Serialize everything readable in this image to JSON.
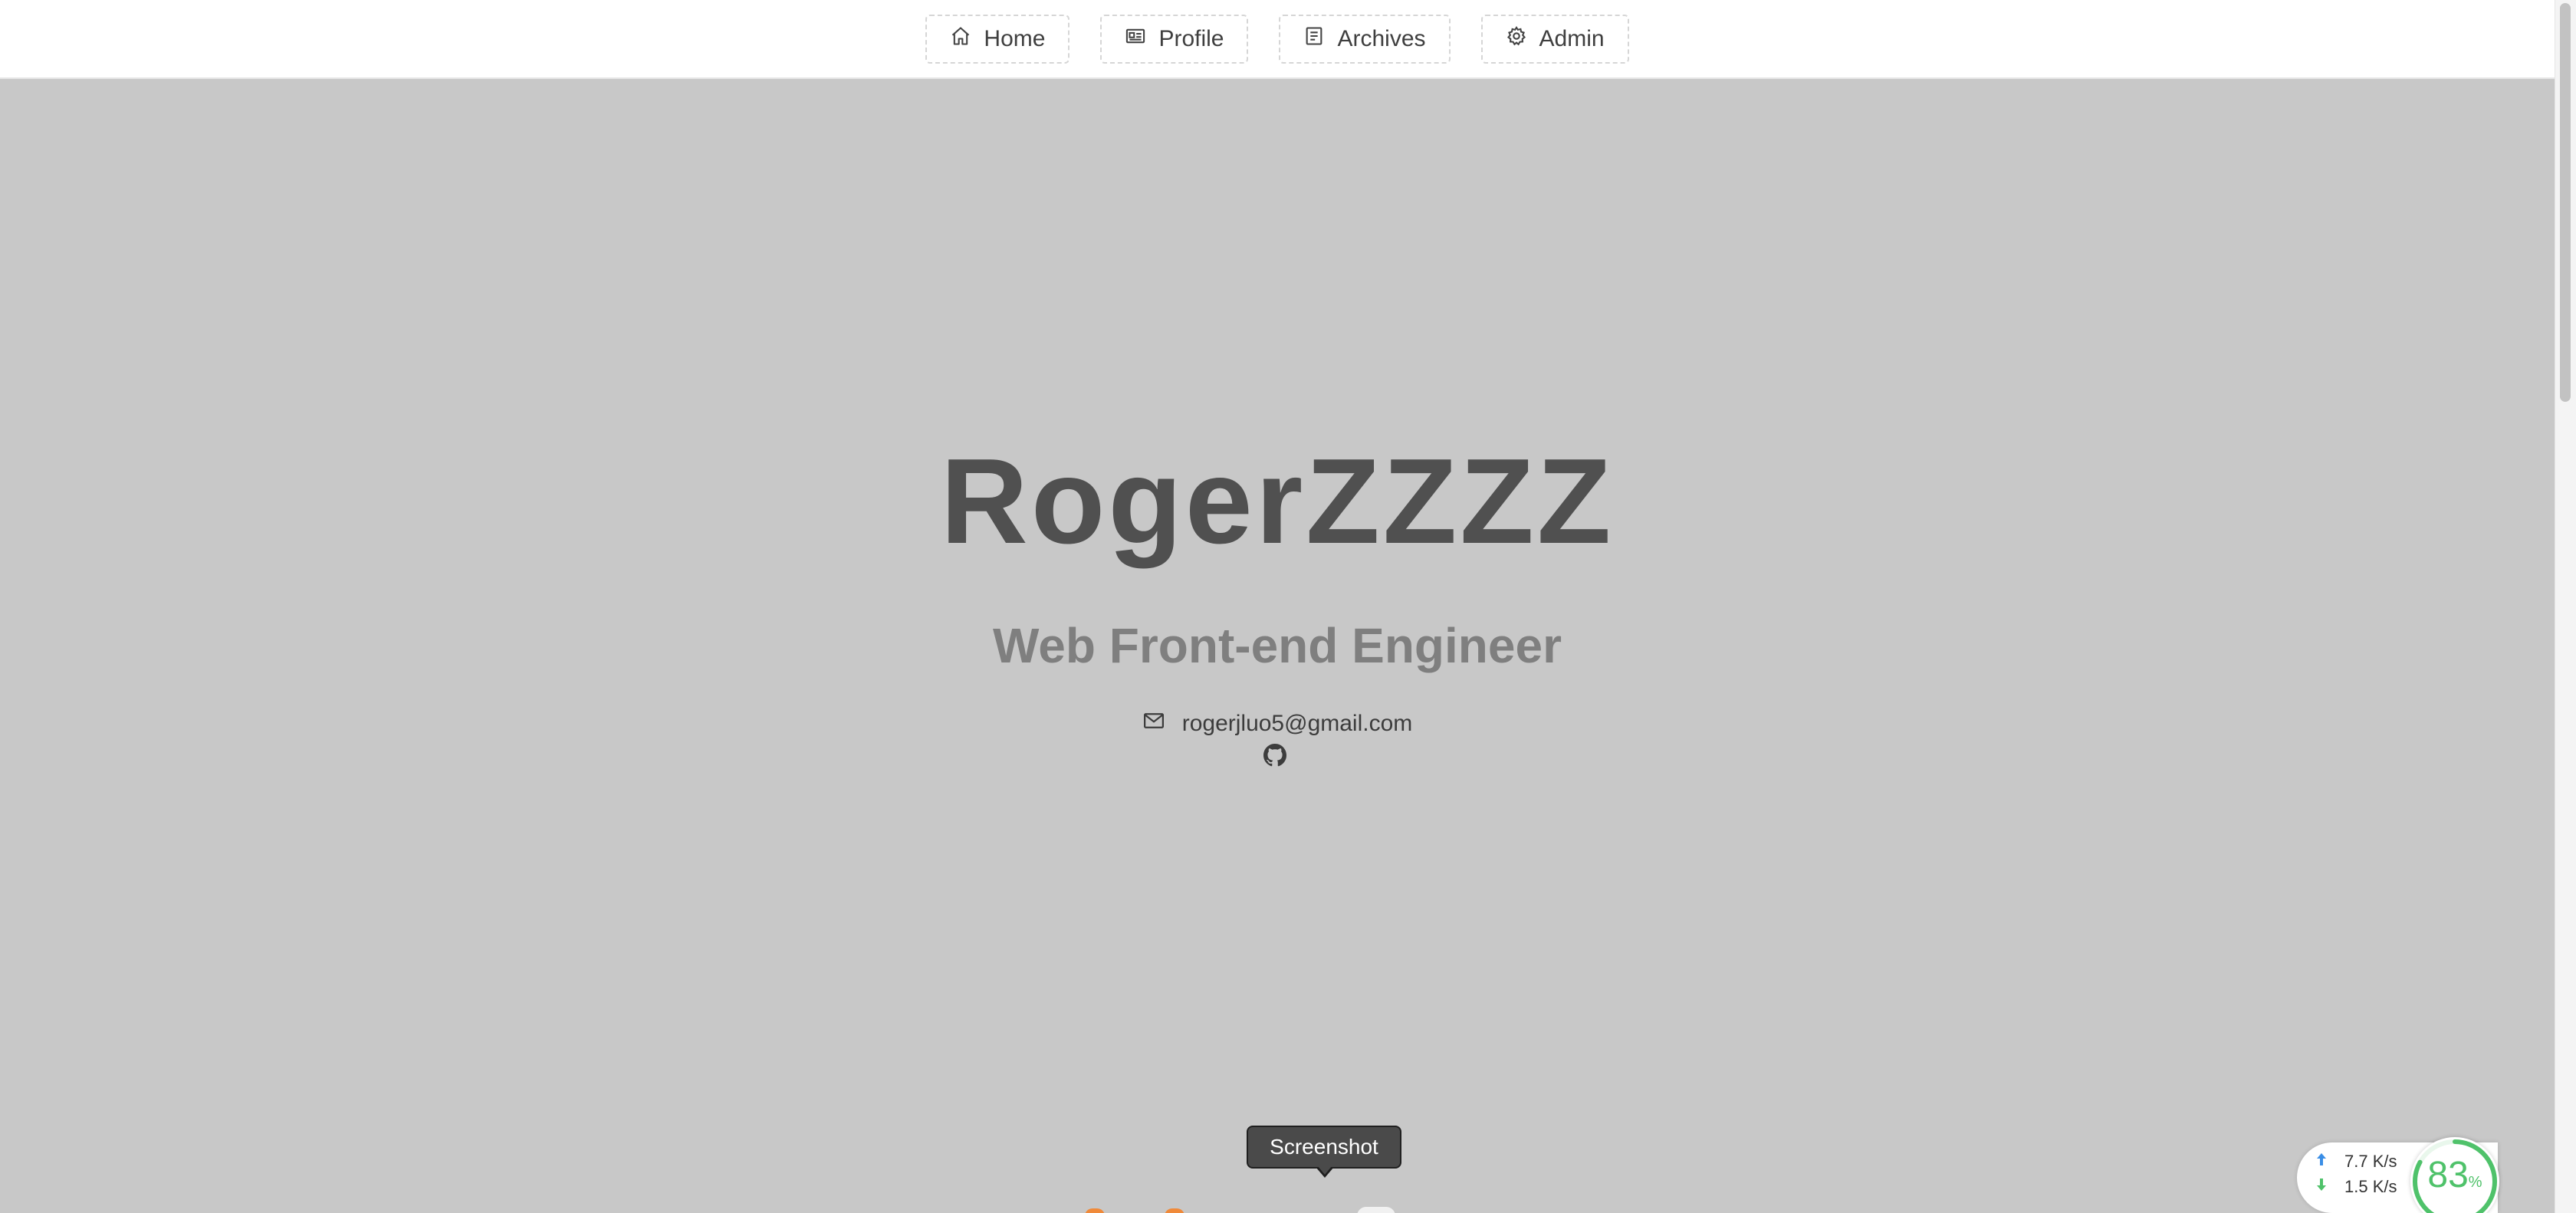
{
  "nav": {
    "items": [
      {
        "label": "Home",
        "icon": "home-icon"
      },
      {
        "label": "Profile",
        "icon": "id-card-icon"
      },
      {
        "label": "Archives",
        "icon": "document-icon"
      },
      {
        "label": "Admin",
        "icon": "gear-icon"
      }
    ]
  },
  "hero": {
    "title": "RogerZZZZ",
    "subtitle": "Web Front-end Engineer",
    "email": "rogerjluo5@gmail.com",
    "email_icon": "mail-icon",
    "github_icon": "github-icon"
  },
  "tooltip": {
    "text": "Screenshot"
  },
  "network": {
    "upload": "7.7 K/s",
    "download": "1.5 K/s",
    "percent": "83",
    "percent_unit": "%",
    "percent_value": 83,
    "color": "#4fc26a"
  },
  "colors": {
    "background": "#c8c8c8",
    "title": "#505050",
    "subtitle": "#7f7f7f"
  }
}
